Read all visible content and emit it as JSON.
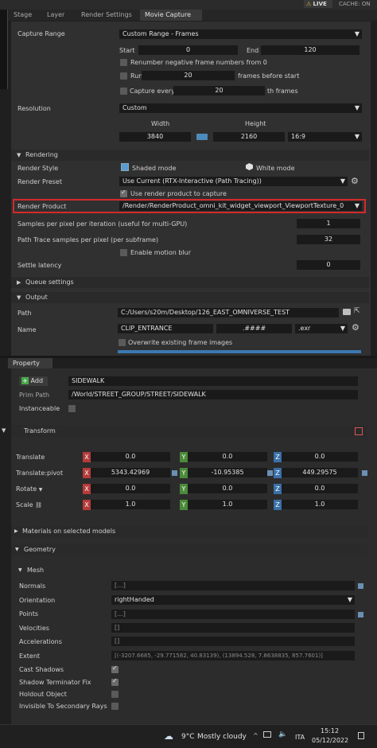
{
  "top_bar": {
    "live_label": "LIVE",
    "cache_label": "CACHE: ON"
  },
  "tabs": [
    {
      "label": "Stage"
    },
    {
      "label": "Layer"
    },
    {
      "label": "Render Settings"
    },
    {
      "label": "Movie Capture"
    }
  ],
  "capture": {
    "range_label": "Capture Range",
    "range_value": "Custom Range - Frames",
    "start_label": "Start",
    "start_value": "0",
    "end_label": "End",
    "end_value": "120",
    "renumber_label": "Renumber negative frame numbers from 0",
    "run_label": "Run",
    "run_value": "20",
    "run_suffix": "frames before start",
    "every_label": "Capture every",
    "every_value": "20",
    "every_suffix": "th frames",
    "resolution_label": "Resolution",
    "resolution_value": "Custom",
    "width_label": "Width",
    "height_label": "Height",
    "width_value": "3840",
    "height_value": "2160",
    "aspect_value": "16:9"
  },
  "rendering": {
    "header": "Rendering",
    "style_label": "Render Style",
    "style_shaded": "Shaded mode",
    "style_white": "White mode",
    "preset_label": "Render Preset",
    "preset_value": "Use Current (RTX-Interactive (Path Tracing))",
    "use_product_label": "Use render product to capture",
    "product_label": "Render Product",
    "product_value": "/Render/RenderProduct_omni_kit_widget_viewport_ViewportTexture_0",
    "spp_label": "Samples per pixel per iteration (useful for multi-GPU)",
    "spp_value": "1",
    "pt_label": "Path Trace samples per pixel (per subframe)",
    "pt_value": "32",
    "motion_blur_label": "Enable motion blur",
    "settle_label": "Settle latency",
    "settle_value": "0",
    "highlight_color": "#d42a2a"
  },
  "queue": {
    "header": "Queue settings"
  },
  "output": {
    "header": "Output",
    "path_label": "Path",
    "path_value": "C:/Users/s20m/Desktop/126_EAST_OMNIVERSE_TEST",
    "name_label": "Name",
    "name_value": "CLIP_ENTRANCE",
    "pattern_value": ".####",
    "ext_value": ".exr",
    "overwrite_label": "Overwrite existing frame images"
  },
  "property": {
    "tab": "Property",
    "add_label": "Add",
    "name_value": "SIDEWALK",
    "prim_path_label": "Prim Path",
    "prim_path_value": "/World/STREET_GROUP/STREET/SIDEWALK",
    "instanceable_label": "Instanceable"
  },
  "transform": {
    "header": "Transform",
    "translate_label": "Translate",
    "translate": [
      "0.0",
      "0.0",
      "0.0"
    ],
    "pivot_label": "Translate:pivot",
    "pivot": [
      "5343.42969",
      "-10.95385",
      "449.29575"
    ],
    "rotate_label": "Rotate",
    "rotate": [
      "0.0",
      "0.0",
      "0.0"
    ],
    "scale_label": "Scale",
    "scale": [
      "1.0",
      "1.0",
      "1.0"
    ],
    "x": "X",
    "y": "Y",
    "z": "Z"
  },
  "materials": {
    "header": "Materials on selected models"
  },
  "geometry": {
    "header": "Geometry",
    "mesh_header": "Mesh",
    "normals_label": "Normals",
    "normals_value": "[...]",
    "orientation_label": "Orientation",
    "orientation_value": "rightHanded",
    "points_label": "Points",
    "points_value": "[...]",
    "velocities_label": "Velocities",
    "velocities_value": "[]",
    "accelerations_label": "Accelerations",
    "accelerations_value": "[]",
    "extent_label": "Extent",
    "extent_value": "[(-3207.6685, -29.771582, 40.83139), (13894.528, 7.8638835, 857.7601)]",
    "cast_shadows_label": "Cast Shadows",
    "shadow_term_label": "Shadow Terminator Fix",
    "holdout_label": "Holdout Object",
    "invisible_label": "Invisible To Secondary Rays"
  },
  "taskbar": {
    "temp": "9°C",
    "weather": "Mostly cloudy",
    "lang": "ITA",
    "time": "15:12",
    "date": "05/12/2022"
  }
}
